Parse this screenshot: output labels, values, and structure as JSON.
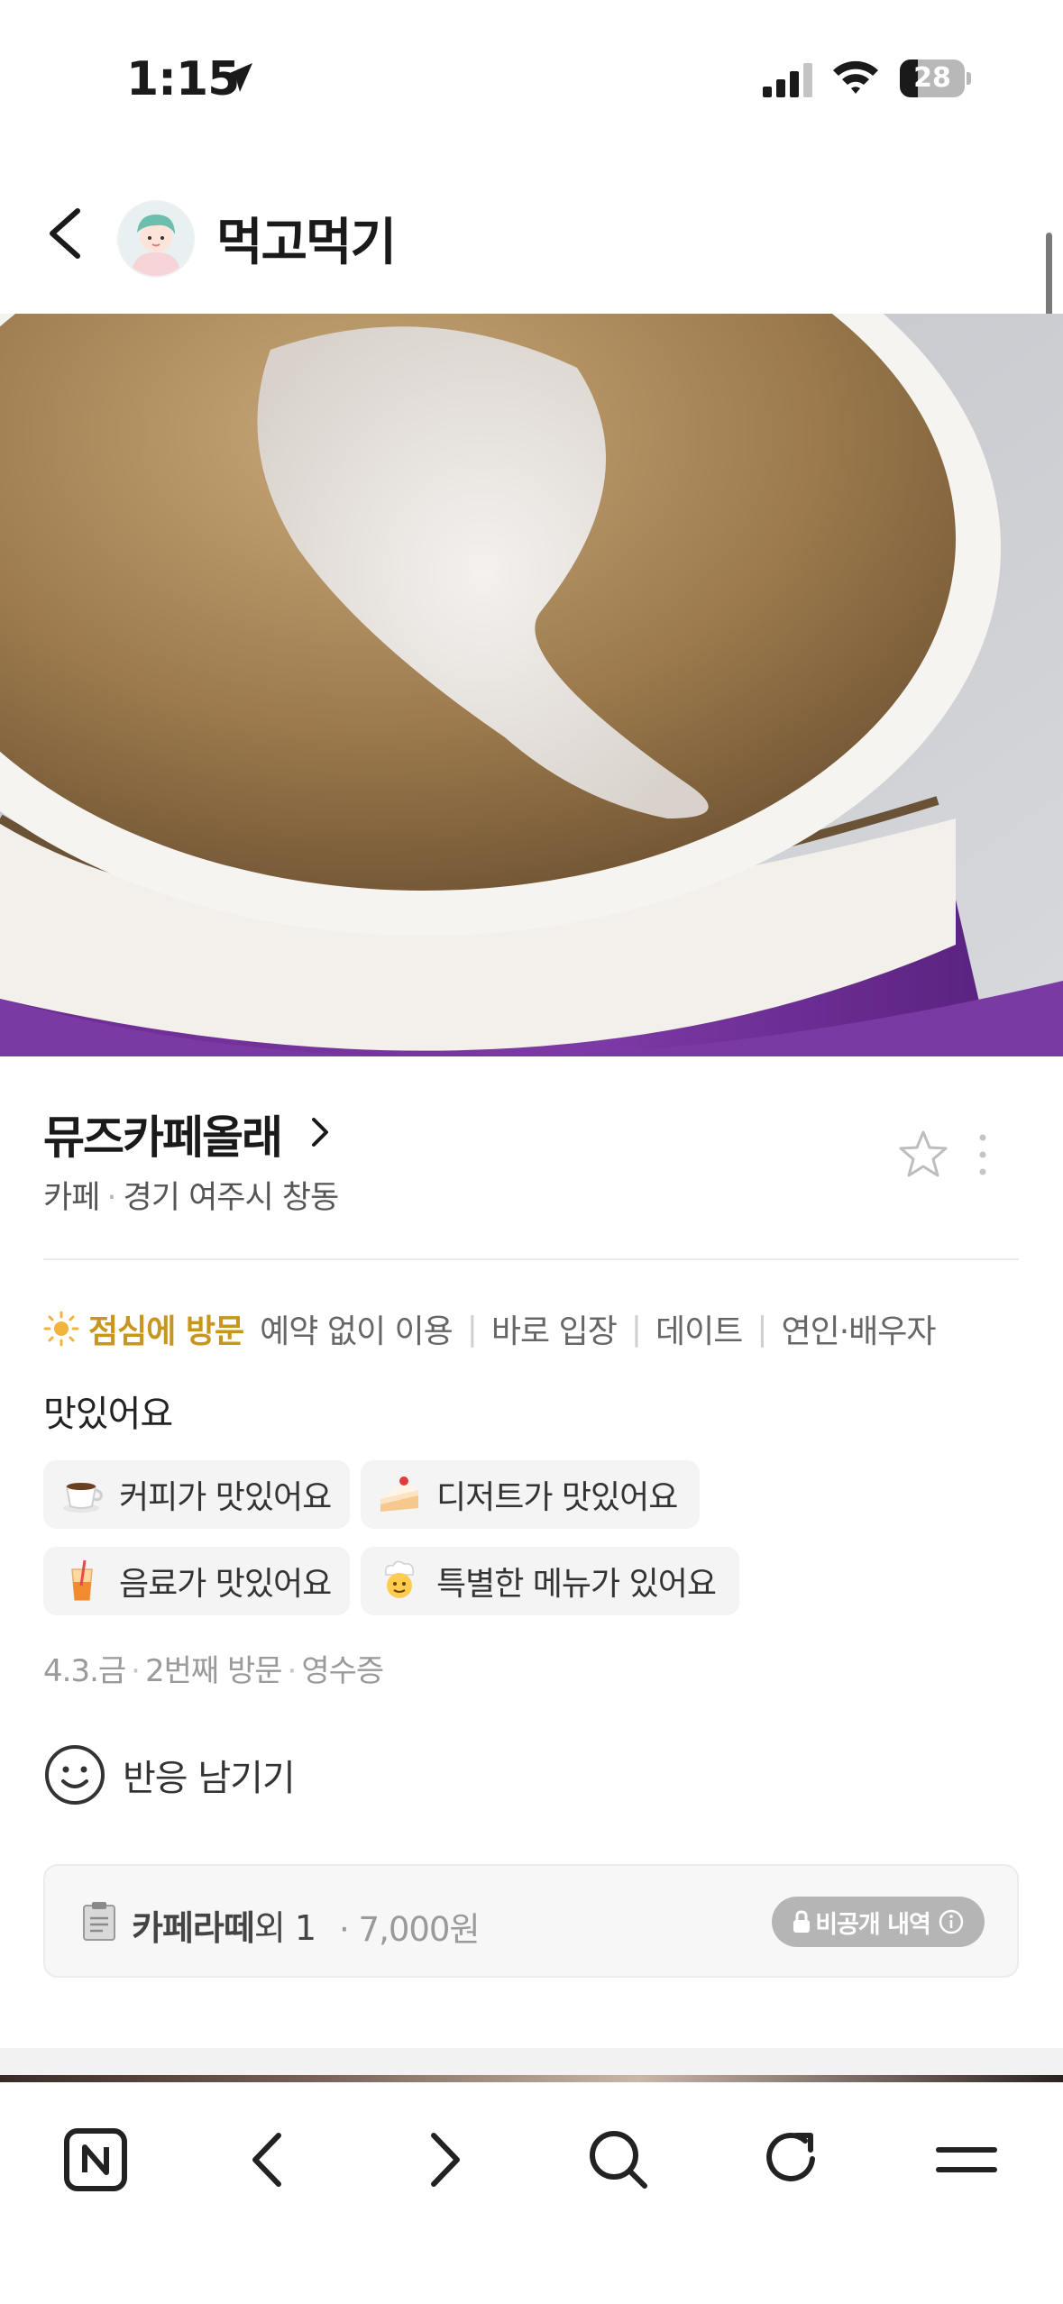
{
  "status_bar": {
    "time": "1:15",
    "battery_level": "28",
    "battery_fraction": 0.28,
    "icons": [
      "location-arrow-icon",
      "cellular-signal-icon",
      "wifi-icon",
      "battery-icon"
    ]
  },
  "header": {
    "back_icon": "chevron-left-icon",
    "blog_name": "먹고먹기"
  },
  "place": {
    "name": "뮤즈카페올래",
    "category": "카페",
    "location": "경기 여주시 창동",
    "separator": "·"
  },
  "visit_tags": {
    "time_icon": "sun-icon",
    "time": "점심에 방문",
    "tags": [
      "예약 없이 이용",
      "바로 입장",
      "데이트",
      "연인·배우자"
    ],
    "separator": "|"
  },
  "review": {
    "text": "맛있어요",
    "keywords": [
      {
        "emoji": "coffee-cup-icon",
        "label": "커피가 맛있어요"
      },
      {
        "emoji": "cake-icon",
        "label": "디저트가 맛있어요"
      },
      {
        "emoji": "drink-icon",
        "label": "음료가 맛있어요"
      },
      {
        "emoji": "chef-icon",
        "label": "특별한 메뉴가 있어요"
      }
    ]
  },
  "visit_meta": {
    "date": "4.3.금",
    "visit_count": "2번째 방문",
    "proof": "영수증"
  },
  "reaction": {
    "icon": "smile-icon",
    "label": "반응 남기기"
  },
  "receipt": {
    "icon": "clipboard-icon",
    "item": "카페라떼",
    "count": "외 1",
    "price_prefix": "·",
    "price": "7,000원",
    "private_label": "비공개 내역",
    "private_icons": [
      "lock-icon",
      "info-icon"
    ]
  },
  "toolbar": {
    "buttons": [
      "naver-home-icon",
      "back-icon",
      "forward-icon",
      "search-icon",
      "refresh-icon",
      "menu-icon"
    ]
  },
  "colors": {
    "accent_time": "#c8961e",
    "chip_bg": "#f4f4f4",
    "badge_bg": "#b5b5b5"
  }
}
